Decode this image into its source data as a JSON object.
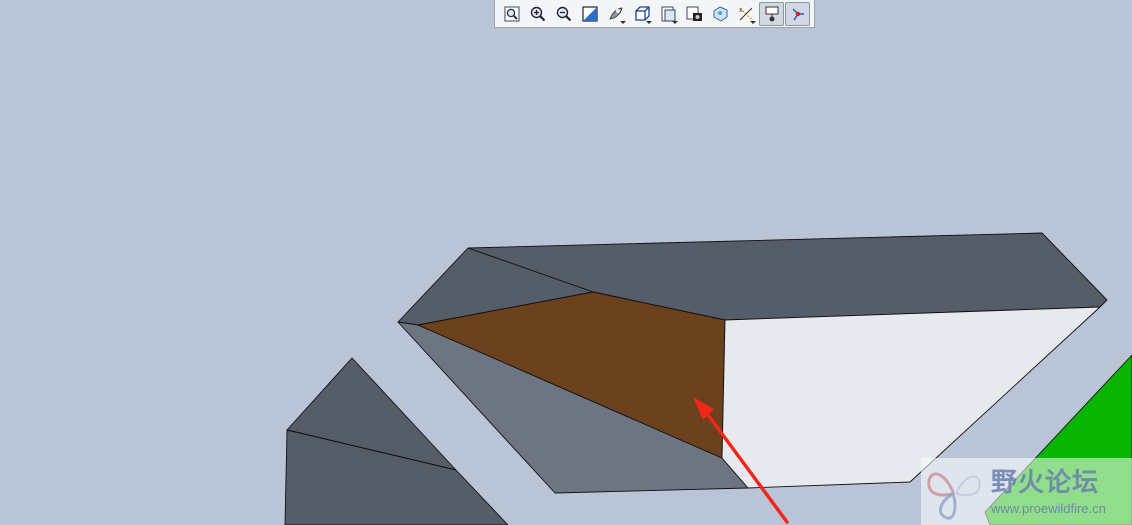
{
  "viewport": {
    "background_color": "#b9c5d6"
  },
  "toolbar": {
    "buttons": [
      {
        "name": "refit-icon",
        "active": false
      },
      {
        "name": "zoom-in-icon",
        "active": false
      },
      {
        "name": "zoom-out-icon",
        "active": false
      },
      {
        "name": "repaint-icon",
        "active": false
      },
      {
        "name": "render-style-icon",
        "active": false,
        "dropdown": true
      },
      {
        "name": "saved-views-icon",
        "active": false,
        "dropdown": true
      },
      {
        "name": "named-view-list-icon",
        "active": false,
        "dropdown": true
      },
      {
        "name": "view-manager-icon",
        "active": false
      },
      {
        "name": "appearance-icon",
        "active": false
      },
      {
        "name": "datum-display-icon",
        "active": false,
        "dropdown": true
      },
      {
        "name": "annotation-display-icon",
        "active": true
      },
      {
        "name": "spin-center-icon",
        "active": true
      }
    ]
  },
  "model": {
    "colors": {
      "dark_face": "#555d69",
      "mid_face": "#6d7582",
      "selected_face": "#6b411e",
      "light_face": "#e7e9ee",
      "green_face": "#09b500",
      "edge": "#111111",
      "arrow": "#f0281c"
    }
  },
  "watermark": {
    "title": "野火论坛",
    "url": "www.proewildfire.cn"
  }
}
